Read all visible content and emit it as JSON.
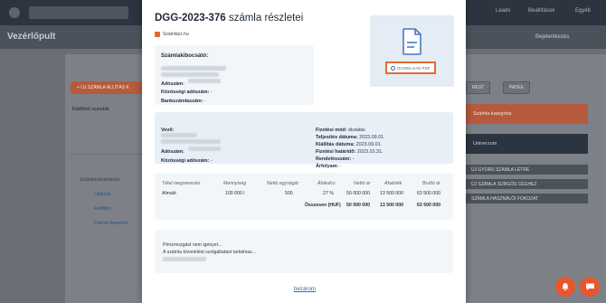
{
  "background": {
    "page_title": "Vezérlőpult",
    "nav": [
      "Leads",
      "Beállítások",
      "Egyéb"
    ],
    "right_link": "Bejelentkezés",
    "left_button": "+ ÚJ SZÁMLA ÁLLÍTÁS K",
    "left_section": "Kiállított számlák",
    "left_items": [
      "Számlanyilvántartás",
      "Listázás",
      "Feltöltés",
      "Partner kezelése"
    ],
    "right_buttons": [
      "REST",
      "PAYEE"
    ],
    "right_cards": [
      "Számla kategória",
      "Univerzum"
    ],
    "right_links": [
      "ÚJ GYORS SZÁMLA LÉTRE",
      "ÚJ SZÁMLA SÜRGŐS CÉGHEZ",
      "SZÁMLA HASZNÁLÓI FOKOZAT"
    ]
  },
  "modal": {
    "title_number": "DGG-2023-376",
    "title_suffix": " számla részletei",
    "provider": "Számlázz.hu",
    "seller": {
      "heading": "Számlakibocsátó:",
      "tax_label": "Adószám:",
      "eu_tax_label": "Közösségi adószám:",
      "eu_tax_value": " -",
      "bank_label": "Bankszámlaszám:",
      "bank_value": " -"
    },
    "download_label": "DOWNLOAD PDF",
    "buyer": {
      "heading": "Vevő:",
      "tax_label": "Adószám:",
      "eu_tax_label": "Közösségi adószám:",
      "eu_tax_value": " -"
    },
    "payment": {
      "method_label": "Fizetési mód:",
      "method_value": " átutalás",
      "fulfilment_label": "Teljesítés dátuma:",
      "fulfilment_value": " 2023.09.01.",
      "issue_label": "Kiállítás dátuma:",
      "issue_value": " 2023.09.01.",
      "due_label": "Fizetési határidő:",
      "due_value": " 2023.10.31.",
      "order_label": "Rendelésszám:",
      "order_value": " -",
      "rate_label": "Árfolyam:",
      "rate_value": " -"
    },
    "items_table": {
      "headers": [
        "Tétel megnevezés",
        "Mennyiség",
        "Nettó egységár",
        "Áfakulcs",
        "Nettó ár",
        "Áfaérték",
        "Bruttó ár"
      ],
      "rows": [
        [
          "Almalé",
          "100 000 l",
          "500",
          "27 %",
          "50 000 000",
          "13 500 000",
          "63 500 000"
        ]
      ],
      "total_label": "Összesen (HUF)",
      "totals": [
        "50 000 000",
        "13 500 000",
        "63 500 000"
      ]
    },
    "notes": [
      "Pénzmozgást nem igényel...",
      "A számla követelést szolgáltatást tartalmaz..."
    ],
    "close_label": "bezárom"
  },
  "colors": {
    "accent": "#e8692d",
    "link": "#3b6ab3",
    "card": "#f3f6f9"
  }
}
